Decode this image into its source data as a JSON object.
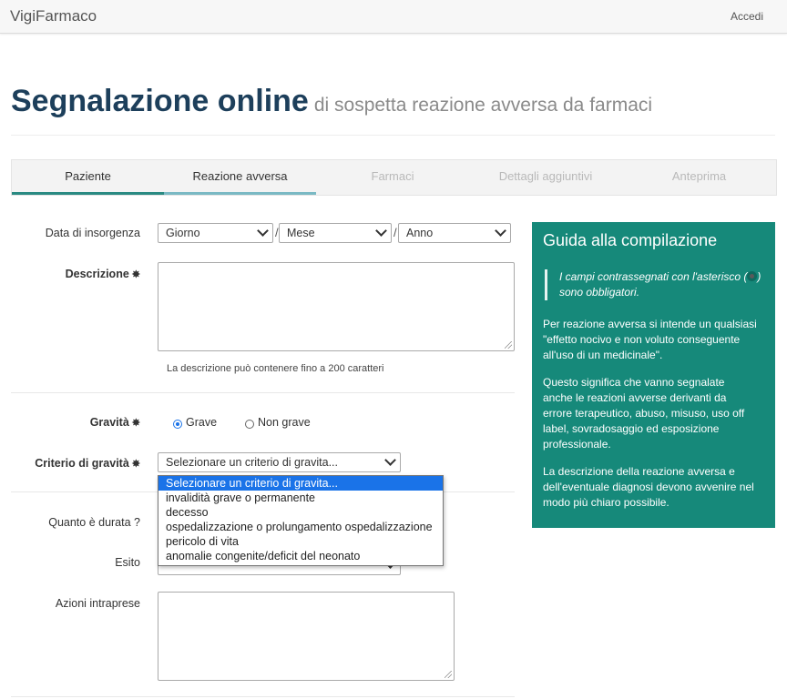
{
  "header": {
    "brand": "VigiFarmaco",
    "login": "Accedi"
  },
  "title": {
    "main": "Segnalazione online",
    "sub": "di sospetta reazione avversa da farmaci"
  },
  "tabs": [
    {
      "label": "Paziente",
      "state": "done"
    },
    {
      "label": "Reazione avversa",
      "state": "active"
    },
    {
      "label": "Farmaci",
      "state": "disabled"
    },
    {
      "label": "Dettagli aggiuntivi",
      "state": "disabled"
    },
    {
      "label": "Anteprima",
      "state": "disabled"
    }
  ],
  "form": {
    "onset_label": "Data di insorgenza",
    "day_value": "Giorno",
    "month_value": "Mese",
    "year_value": "Anno",
    "slash": "/",
    "description_label": "Descrizione",
    "description_hint": "La descrizione può contenere fino a 200 caratteri",
    "severity_label": "Gravità",
    "severity_options": [
      "Grave",
      "Non grave"
    ],
    "severity_selected": "Grave",
    "criterion_label": "Criterio di gravità",
    "criterion_value": "Selezionare un criterio di gravita...",
    "criterion_options": [
      "Selezionare un criterio di gravita...",
      "invalidità grave o permanente",
      "decesso",
      "ospedalizzazione o prolungamento ospedalizzazione",
      "pericolo di vita",
      "anomalie congenite/deficit del neonato"
    ],
    "duration_label": "Quanto è durata ?",
    "outcome_label": "Esito",
    "actions_label": "Azioni intraprese",
    "required_mark": "✸"
  },
  "guide": {
    "title": "Guida alla compilazione",
    "note_before": "I campi contrassegnati con l'asterisco (",
    "note_after": ") sono obbligatori.",
    "p1": "Per reazione avversa si intende un qualsiasi \"effetto nocivo e non voluto conseguente all'uso di un medicinale\".",
    "p2": "Questo significa che vanno segnalate anche le reazioni avverse derivanti da errore terapeutico, abuso, misuso, uso off label, sovradosaggio ed esposizione professionale.",
    "p3": "La descrizione della reazione avversa e dell'eventuale diagnosi devono avvenire nel modo più chiaro possibile."
  },
  "colors": {
    "accent": "#16897a",
    "title": "#1d3f5b",
    "select_highlight": "#1a73e8"
  }
}
